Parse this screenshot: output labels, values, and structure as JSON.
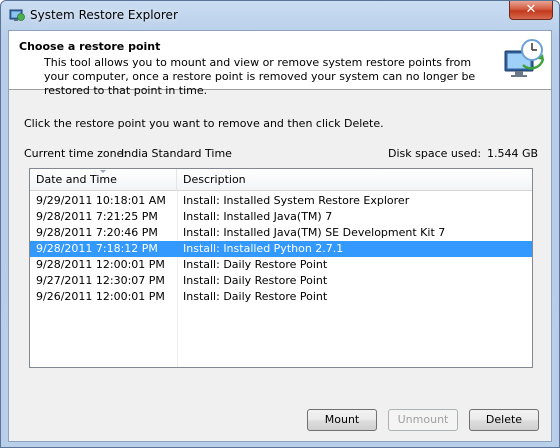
{
  "window": {
    "title": "System Restore Explorer",
    "close_glyph": "✕"
  },
  "header": {
    "title": "Choose a restore point",
    "description": "This tool allows you to mount and view or remove system restore points from your computer, once a restore point is removed your system can no longer be restored to that point in time.",
    "icon": "system-restore-icon"
  },
  "instruction": "Click the restore point you want to remove and then click Delete.",
  "timezone": {
    "label": "Current time zone:",
    "value": "India Standard Time"
  },
  "disk": {
    "label": "Disk space used:",
    "value": "1.544 GB"
  },
  "table": {
    "columns": [
      "Date and Time",
      "Description"
    ],
    "rows": [
      {
        "date": "9/29/2011 10:18:01 AM",
        "desc": "Install: Installed System Restore Explorer"
      },
      {
        "date": "9/28/2011 7:21:25 PM",
        "desc": "Install: Installed Java(TM) 7"
      },
      {
        "date": "9/28/2011 7:20:46 PM",
        "desc": "Install: Installed Java(TM) SE Development Kit 7"
      },
      {
        "date": "9/28/2011 7:18:12 PM",
        "desc": "Install: Installed Python 2.7.1"
      },
      {
        "date": "9/28/2011 12:00:01 PM",
        "desc": "Install: Daily Restore Point"
      },
      {
        "date": "9/27/2011 12:30:07 PM",
        "desc": "Install: Daily Restore Point"
      },
      {
        "date": "9/26/2011 12:00:01 PM",
        "desc": "Install: Daily Restore Point"
      }
    ],
    "selected_index": 3
  },
  "buttons": {
    "mount": "Mount",
    "unmount": "Unmount",
    "delete": "Delete"
  },
  "colors": {
    "selection": "#3399ff",
    "close_button": "#c2391d"
  }
}
